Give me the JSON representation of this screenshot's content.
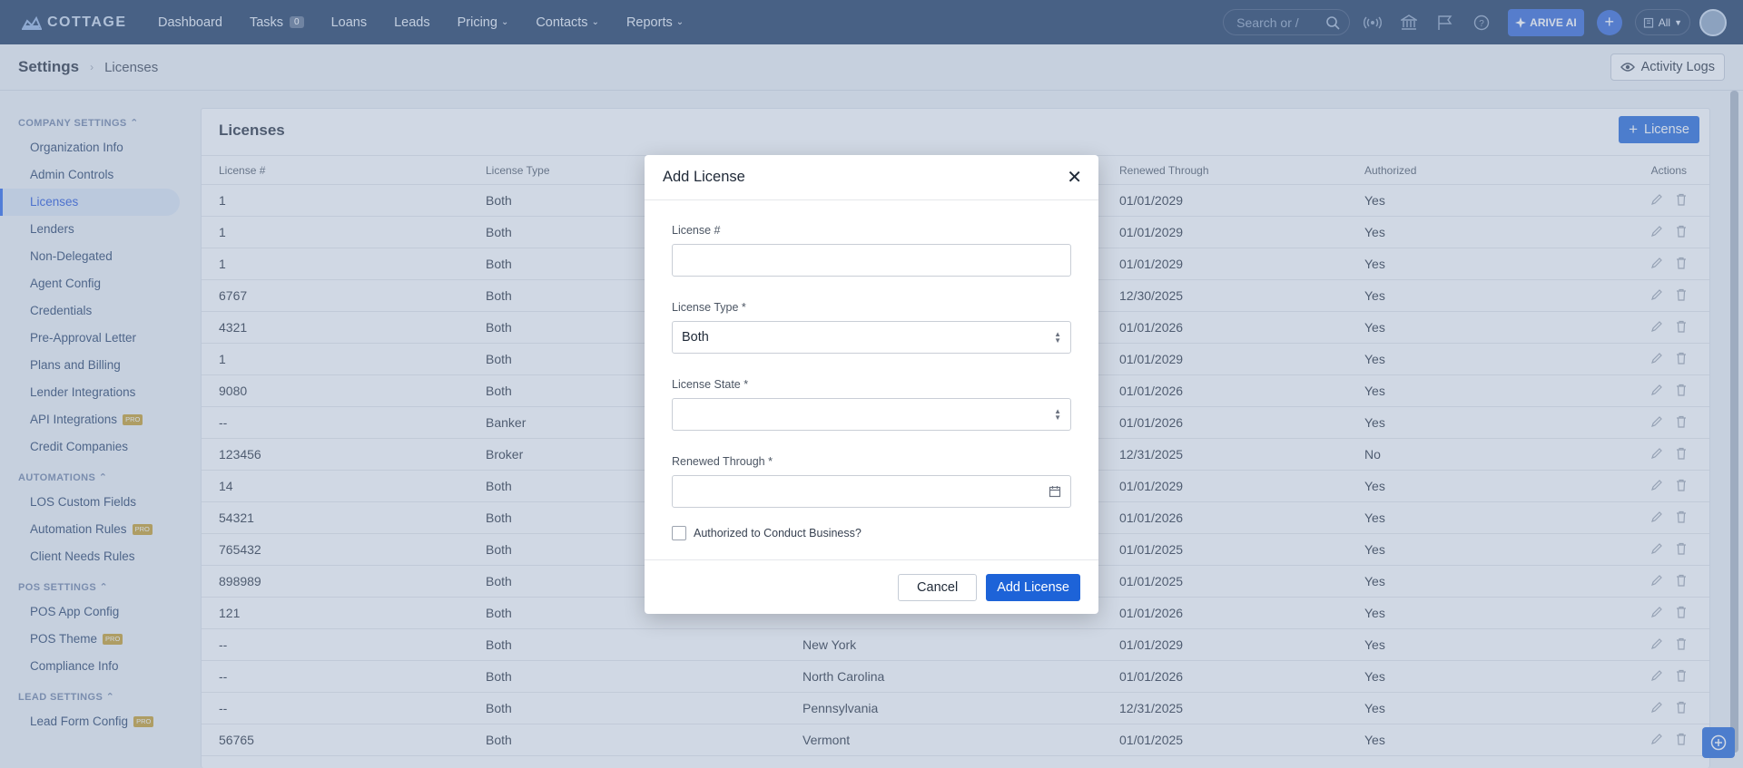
{
  "nav": {
    "brand": "COTTAGE",
    "items": [
      {
        "label": "Dashboard",
        "badge": "",
        "dropdown": false
      },
      {
        "label": "Tasks",
        "badge": "0",
        "dropdown": false
      },
      {
        "label": "Loans",
        "badge": "",
        "dropdown": false
      },
      {
        "label": "Leads",
        "badge": "",
        "dropdown": false
      },
      {
        "label": "Pricing",
        "badge": "",
        "dropdown": true
      },
      {
        "label": "Contacts",
        "badge": "",
        "dropdown": true
      },
      {
        "label": "Reports",
        "badge": "",
        "dropdown": true
      }
    ],
    "search_placeholder": "Search or /",
    "ai_label": "ARIVE AI",
    "scope_label": "All"
  },
  "breadcrumb": {
    "root": "Settings",
    "current": "Licenses"
  },
  "activity_logs_label": "Activity Logs",
  "sidebar": {
    "sections": [
      {
        "title": "COMPANY SETTINGS",
        "items": [
          {
            "label": "Organization Info",
            "pro": false,
            "active": false
          },
          {
            "label": "Admin Controls",
            "pro": false,
            "active": false
          },
          {
            "label": "Licenses",
            "pro": false,
            "active": true
          },
          {
            "label": "Lenders",
            "pro": false,
            "active": false
          },
          {
            "label": "Non-Delegated",
            "pro": false,
            "active": false
          },
          {
            "label": "Agent Config",
            "pro": false,
            "active": false
          },
          {
            "label": "Credentials",
            "pro": false,
            "active": false
          },
          {
            "label": "Pre-Approval Letter",
            "pro": false,
            "active": false
          },
          {
            "label": "Plans and Billing",
            "pro": false,
            "active": false
          },
          {
            "label": "Lender Integrations",
            "pro": false,
            "active": false
          },
          {
            "label": "API Integrations",
            "pro": true,
            "active": false
          },
          {
            "label": "Credit Companies",
            "pro": false,
            "active": false
          }
        ]
      },
      {
        "title": "AUTOMATIONS",
        "items": [
          {
            "label": "LOS Custom Fields",
            "pro": false,
            "active": false
          },
          {
            "label": "Automation Rules",
            "pro": true,
            "active": false
          },
          {
            "label": "Client Needs Rules",
            "pro": false,
            "active": false
          }
        ]
      },
      {
        "title": "POS SETTINGS",
        "items": [
          {
            "label": "POS App Config",
            "pro": false,
            "active": false
          },
          {
            "label": "POS Theme",
            "pro": true,
            "active": false
          },
          {
            "label": "Compliance Info",
            "pro": false,
            "active": false
          }
        ]
      },
      {
        "title": "LEAD SETTINGS",
        "items": [
          {
            "label": "Lead Form Config",
            "pro": true,
            "active": false
          }
        ]
      }
    ],
    "pro_label": "PRO"
  },
  "licenses": {
    "title": "Licenses",
    "add_button_label": "License",
    "columns": [
      "License #",
      "License Type",
      "",
      "Renewed Through",
      "Authorized",
      "Actions"
    ],
    "rows": [
      {
        "number": "1",
        "type": "Both",
        "state": "",
        "renewed": "01/01/2029",
        "authorized": "Yes"
      },
      {
        "number": "1",
        "type": "Both",
        "state": "",
        "renewed": "01/01/2029",
        "authorized": "Yes"
      },
      {
        "number": "1",
        "type": "Both",
        "state": "",
        "renewed": "01/01/2029",
        "authorized": "Yes"
      },
      {
        "number": "6767",
        "type": "Both",
        "state": "",
        "renewed": "12/30/2025",
        "authorized": "Yes"
      },
      {
        "number": "4321",
        "type": "Both",
        "state": "",
        "renewed": "01/01/2026",
        "authorized": "Yes"
      },
      {
        "number": "1",
        "type": "Both",
        "state": "",
        "renewed": "01/01/2029",
        "authorized": "Yes"
      },
      {
        "number": "9080",
        "type": "Both",
        "state": "",
        "renewed": "01/01/2026",
        "authorized": "Yes"
      },
      {
        "number": "--",
        "type": "Banker",
        "state": "",
        "renewed": "01/01/2026",
        "authorized": "Yes"
      },
      {
        "number": "123456",
        "type": "Broker",
        "state": "",
        "renewed": "12/31/2025",
        "authorized": "No"
      },
      {
        "number": "14",
        "type": "Both",
        "state": "",
        "renewed": "01/01/2029",
        "authorized": "Yes"
      },
      {
        "number": "54321",
        "type": "Both",
        "state": "",
        "renewed": "01/01/2026",
        "authorized": "Yes"
      },
      {
        "number": "765432",
        "type": "Both",
        "state": "",
        "renewed": "01/01/2025",
        "authorized": "Yes"
      },
      {
        "number": "898989",
        "type": "Both",
        "state": "",
        "renewed": "01/01/2025",
        "authorized": "Yes"
      },
      {
        "number": "121",
        "type": "Both",
        "state": "",
        "renewed": "01/01/2026",
        "authorized": "Yes"
      },
      {
        "number": "--",
        "type": "Both",
        "state": "New York",
        "renewed": "01/01/2029",
        "authorized": "Yes"
      },
      {
        "number": "--",
        "type": "Both",
        "state": "North Carolina",
        "renewed": "01/01/2026",
        "authorized": "Yes"
      },
      {
        "number": "--",
        "type": "Both",
        "state": "Pennsylvania",
        "renewed": "12/31/2025",
        "authorized": "Yes"
      },
      {
        "number": "56765",
        "type": "Both",
        "state": "Vermont",
        "renewed": "01/01/2025",
        "authorized": "Yes"
      }
    ]
  },
  "modal": {
    "title": "Add License",
    "license_number_label": "License #",
    "license_number_value": "",
    "license_type_label": "License Type *",
    "license_type_value": "Both",
    "license_state_label": "License State *",
    "license_state_value": "",
    "renewed_label": "Renewed Through *",
    "renewed_value": "",
    "authorized_label": "Authorized to Conduct Business?",
    "cancel_label": "Cancel",
    "submit_label": "Add License"
  },
  "colors": {
    "nav_bg": "#16325c",
    "accent": "#1d63d8",
    "overlay": "rgba(143,163,190,0.42)"
  }
}
